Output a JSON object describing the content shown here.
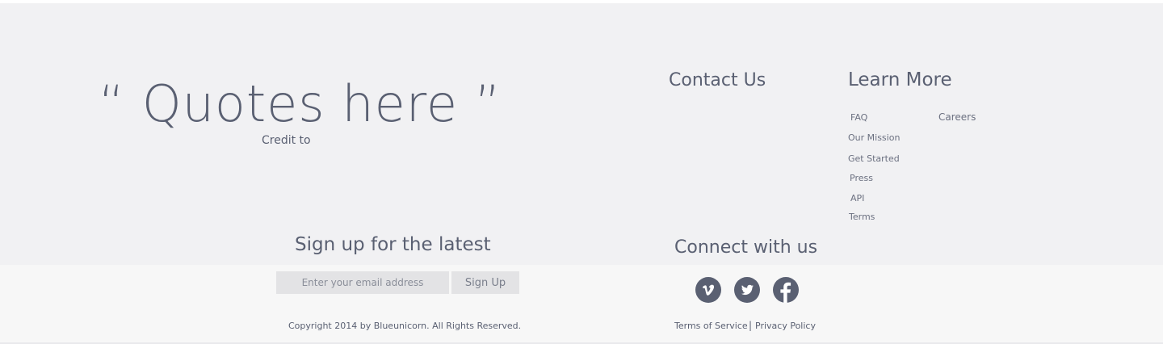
{
  "quote": {
    "text": "“ Quotes here ”",
    "credit": "Credit to"
  },
  "contact": {
    "heading": "Contact Us"
  },
  "learn_more": {
    "heading": "Learn More",
    "links": {
      "faq": "FAQ",
      "careers": "Careers",
      "our_mission": "Our Mission",
      "get_started": "Get Started",
      "press": "Press",
      "api": "API",
      "terms": "Terms"
    }
  },
  "signup": {
    "heading": "Sign up for the latest",
    "email_placeholder": "Enter your email address",
    "button_label": "Sign Up"
  },
  "connect": {
    "heading": "Connect with us",
    "icons": [
      "vimeo-icon",
      "twitter-icon",
      "facebook-icon"
    ],
    "icon_color": "#5a6072"
  },
  "footer": {
    "copyright": "Copyright 2014 by Blueunicorn. All Rights Reserved.",
    "terms_of_service": "Terms of Service",
    "separator": "|",
    "privacy_policy": "Privacy Policy"
  },
  "colors": {
    "text": "#5a6072",
    "upper_background": "#f1f1f3",
    "lower_background": "#f7f7f7",
    "input_background": "#e3e3e5"
  }
}
